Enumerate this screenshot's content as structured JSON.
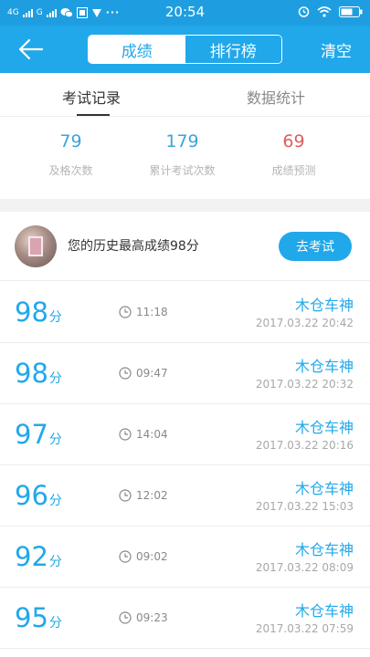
{
  "status_bar": {
    "left_items": [
      "4G",
      "G"
    ],
    "time": "20:54",
    "battery_icon": "battery-icon"
  },
  "header": {
    "tabs": [
      {
        "label": "成绩",
        "active": true
      },
      {
        "label": "排行榜",
        "active": false
      }
    ],
    "clear_label": "清空"
  },
  "subtabs": [
    {
      "label": "考试记录",
      "active": true
    },
    {
      "label": "数据统计",
      "active": false
    }
  ],
  "stats": [
    {
      "value": "79",
      "label": "及格次数",
      "color": "#3aa6d8"
    },
    {
      "value": "179",
      "label": "累计考试次数",
      "color": "#3aa6d8"
    },
    {
      "value": "69",
      "label": "成绩预测",
      "color": "#e25c5c"
    }
  ],
  "best": {
    "text": "您的历史最高成绩98分",
    "button_label": "去考试"
  },
  "records": [
    {
      "score": "98",
      "unit": "分",
      "duration": "11:18",
      "name": "木仓车神",
      "datetime": "2017.03.22  20:42"
    },
    {
      "score": "98",
      "unit": "分",
      "duration": "09:47",
      "name": "木仓车神",
      "datetime": "2017.03.22  20:32"
    },
    {
      "score": "97",
      "unit": "分",
      "duration": "14:04",
      "name": "木仓车神",
      "datetime": "2017.03.22  20:16"
    },
    {
      "score": "96",
      "unit": "分",
      "duration": "12:02",
      "name": "木仓车神",
      "datetime": "2017.03.22  15:03"
    },
    {
      "score": "92",
      "unit": "分",
      "duration": "09:02",
      "name": "木仓车神",
      "datetime": "2017.03.22  08:09"
    },
    {
      "score": "95",
      "unit": "分",
      "duration": "09:23",
      "name": "木仓车神",
      "datetime": "2017.03.22  07:59"
    }
  ]
}
